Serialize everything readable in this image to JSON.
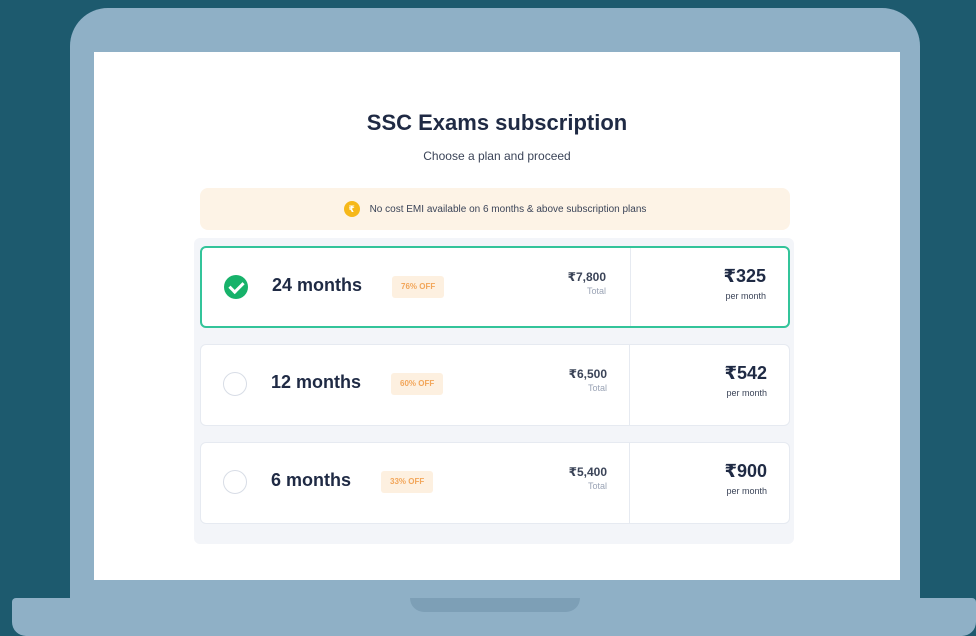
{
  "page": {
    "title": "SSC Exams subscription",
    "subtitle": "Choose a plan and proceed"
  },
  "banner": {
    "icon": "emi-badge-icon",
    "text": "No cost EMI available on 6 months & above subscription plans"
  },
  "plans": [
    {
      "duration": "24 months",
      "discount": "76% OFF",
      "total": "₹7,800",
      "total_label": "Total",
      "price": "₹325",
      "price_label": "per month",
      "selected": true
    },
    {
      "duration": "12 months",
      "discount": "60% OFF",
      "total": "₹6,500",
      "total_label": "Total",
      "price": "₹542",
      "price_label": "per month",
      "selected": false
    },
    {
      "duration": "6 months",
      "discount": "33% OFF",
      "total": "₹5,400",
      "total_label": "Total",
      "price": "₹900",
      "price_label": "per month",
      "selected": false
    }
  ],
  "colors": {
    "background": "#1d5a6e",
    "laptop": "#8fb0c6",
    "selected_border": "#33c49a",
    "check": "#17b26a",
    "discount_text": "#f2a65a",
    "banner_bg": "#fdf3e6"
  }
}
